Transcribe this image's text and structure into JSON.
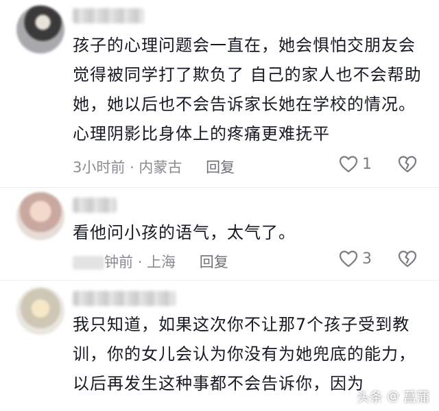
{
  "comments": [
    {
      "text": "孩子的心理问题会一直在，她会惧怕交朋友会觉得被同学打了欺负了 自己的家人也不会帮助她，她以后也不会告诉家长她在学校的情况。心理阴影比身体上的疼痛更难抚平",
      "time": "3小时前",
      "location": "内蒙古",
      "reply_label": "回复",
      "likes": "1"
    },
    {
      "text": "看他问小孩的语气，太气了。",
      "time": "钟前",
      "location": "上海",
      "reply_label": "回复",
      "likes": "3"
    },
    {
      "text": "我只知道，如果这次你不让那7个孩子受到教训，你的女儿会认为你没有为她兜底的能力，以后再发生这种事都不会告诉你，因为"
    }
  ],
  "watermark": {
    "brand": "头条",
    "separator": "@",
    "author": "菖蒲"
  },
  "colors": {
    "text": "#161823",
    "meta": "#8a8b91",
    "icon": "#7a7b80"
  },
  "icons": [
    "heart-outline-icon",
    "broken-heart-icon"
  ]
}
